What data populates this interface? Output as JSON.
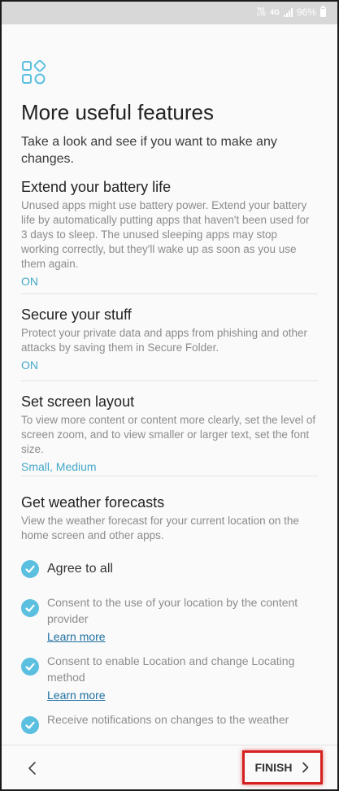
{
  "statusbar": {
    "volte": "Vo)) LTE",
    "network": "4G",
    "battery": "96%"
  },
  "page": {
    "title": "More useful features",
    "intro": "Take a look and see if you want to make any changes."
  },
  "sections": [
    {
      "title": "Extend your battery life",
      "description": "Unused apps might use battery power. Extend your battery life by automatically putting apps that haven't been used for 3 days to sleep. The unused sleeping apps may stop working correctly, but they'll wake up as soon as you use them again.",
      "value": "ON"
    },
    {
      "title": "Secure your stuff",
      "description": "Protect your private data and apps from phishing and other attacks by saving them in Secure Folder.",
      "value": "ON"
    },
    {
      "title": "Set screen layout",
      "description": "To view more content or content more clearly, set the level of screen zoom, and to view smaller or larger text, set the font size.",
      "value": "Small, Medium"
    },
    {
      "title": "Get weather forecasts",
      "description": "View the weather forecast for your current location on the home screen and other apps."
    }
  ],
  "consents": {
    "agree_all": "Agree to all",
    "items": [
      {
        "text": "Consent to the use of your location by the content provider",
        "link": "Learn more"
      },
      {
        "text": "Consent to enable Location and change Locating method",
        "link": "Learn more"
      },
      {
        "text": "Receive notifications on changes to the weather"
      }
    ]
  },
  "footer": {
    "finish_label": "FINISH"
  },
  "colors": {
    "accent": "#5bbfe0",
    "link": "#1f6fa0",
    "highlight": "#d42020"
  }
}
